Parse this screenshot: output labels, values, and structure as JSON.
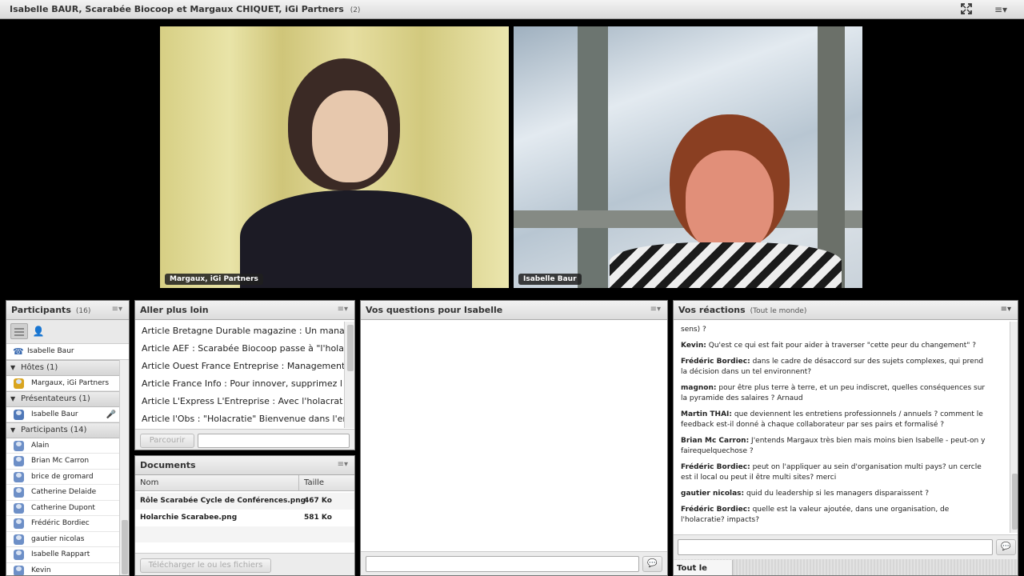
{
  "topbar": {
    "title": "Isabelle BAUR, Scarabée Biocoop et Margaux CHIQUET, iGi Partners",
    "count": "(2)"
  },
  "videos": [
    {
      "label": "Margaux, iGi Partners"
    },
    {
      "label": "Isabelle Baur"
    }
  ],
  "participants": {
    "title": "Participants",
    "count": "(16)",
    "current_speaker": "Isabelle Baur",
    "sections": [
      {
        "label": "Hôtes (1)",
        "people": [
          "Margaux, iGi Partners"
        ]
      },
      {
        "label": "Présentateurs (1)",
        "people": [
          "Isabelle Baur"
        ]
      },
      {
        "label": "Participants (14)",
        "people": [
          "Alain",
          "Brian Mc Carron",
          "brice de gromard",
          "Catherine Delaide",
          "Catherine Dupont",
          "Frédéric Bordiec",
          "gautier nicolas",
          "Isabelle Rappart",
          "Kevin"
        ]
      }
    ]
  },
  "links": {
    "title": "Aller plus loin",
    "items": [
      "Article Bretagne Durable magazine : Un manag",
      "Article AEF : Scarabée Biocoop passe à \"l'holac",
      "Article Ouest France Entreprise : Management",
      "Article France Info : Pour innover, supprimez l",
      "Article L'Express  L'Entreprise : Avec l'holacrat",
      "Article l'Obs : \"Holacratie\" Bienvenue dans l'er"
    ],
    "browse_label": "Parcourir"
  },
  "documents": {
    "title": "Documents",
    "col_name": "Nom",
    "col_size": "Taille",
    "rows": [
      {
        "name": "Rôle Scarabée Cycle de Conférences.png",
        "size": "467 Ko"
      },
      {
        "name": "Holarchie Scarabee.png",
        "size": "581 Ko"
      }
    ],
    "download_label": "Télécharger le ou les fichiers"
  },
  "questions": {
    "title": "Vos questions pour Isabelle"
  },
  "chat": {
    "title": "Vos réactions",
    "scope": "(Tout le monde)",
    "messages": [
      {
        "author": "",
        "text": "sens) ?"
      },
      {
        "author": "Kevin:",
        "text": "Qu'est ce qui est fait pour aider à traverser \"cette peur du changement\" ?"
      },
      {
        "author": "Frédéric Bordiec:",
        "text": "dans le cadre de désaccord sur des sujets complexes, qui prend la décision dans un tel environnent?"
      },
      {
        "author": "magnon:",
        "text": "pour être plus terre à terre, et un peu indiscret, quelles conséquences sur la pyramide des salaires ? Arnaud"
      },
      {
        "author": "Martin THAI:",
        "text": "que deviennent les entretiens professionnels / annuels ? comment le feedback est-il donné à chaque collaborateur par ses pairs et formalisé ?"
      },
      {
        "author": "Brian Mc Carron:",
        "text": "J'entends Margaux très bien mais moins bien Isabelle - peut-on y fairequelquechose ?"
      },
      {
        "author": "Frédéric Bordiec:",
        "text": "peut on l'appliquer au sein d'organisation multi pays? un cercle est il local ou peut il être multi sites? merci"
      },
      {
        "author": "gautier nicolas:",
        "text": "quid du leadership si les managers disparaissent ?"
      },
      {
        "author": "Frédéric Bordiec:",
        "text": "quelle est la valeur ajoutée, dans une organisation, de l'holacratie? impacts?"
      }
    ],
    "recipient_label": "Tout le monde"
  },
  "colors": {
    "pod_header": "#dcdcdc",
    "host_icon": "#d9a520",
    "participant_icon": "#6d8fc7"
  }
}
